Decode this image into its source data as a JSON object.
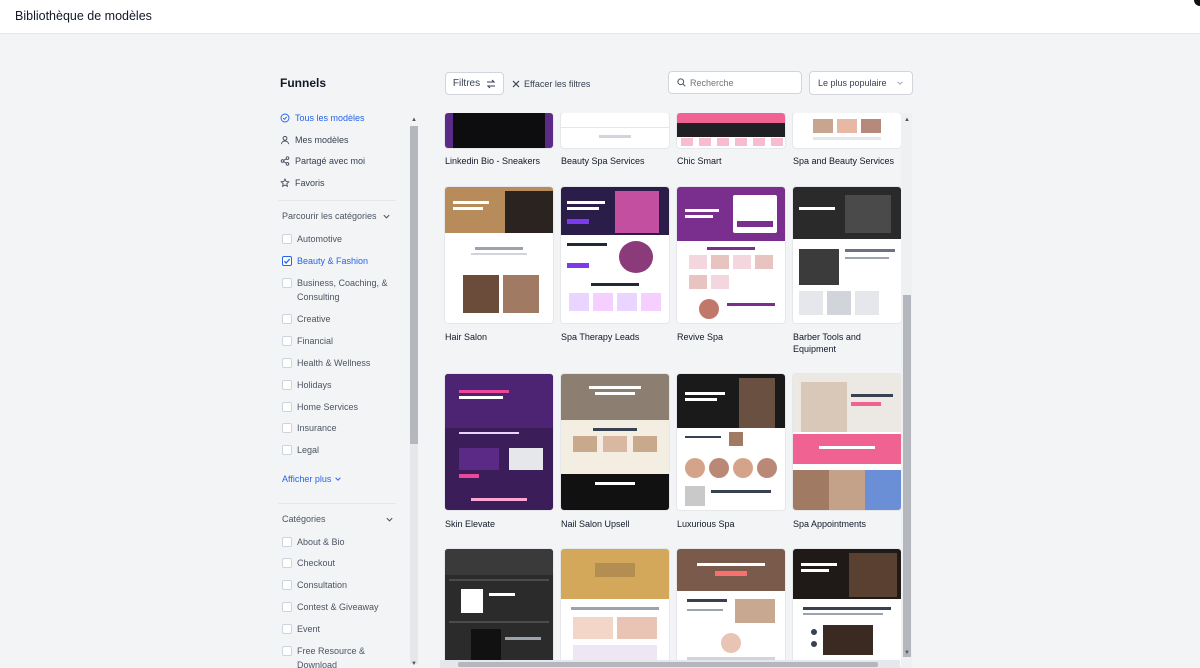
{
  "window": {
    "title": "Bibliothèque de modèles"
  },
  "sidebar": {
    "title": "Funnels",
    "nav": [
      {
        "label": "Tous les modèles",
        "icon": "check-circle-icon",
        "active": true
      },
      {
        "label": "Mes modèles",
        "icon": "user-icon",
        "active": false
      },
      {
        "label": "Partagé avec moi",
        "icon": "share-icon",
        "active": false
      },
      {
        "label": "Favoris",
        "icon": "star-icon",
        "active": false
      }
    ],
    "browse_categories": {
      "label": "Parcourir les catégories",
      "items": [
        {
          "label": "Automotive",
          "checked": false
        },
        {
          "label": "Beauty & Fashion",
          "checked": true
        },
        {
          "label": "Business, Coaching, & Consulting",
          "checked": false
        },
        {
          "label": "Creative",
          "checked": false
        },
        {
          "label": "Financial",
          "checked": false
        },
        {
          "label": "Health & Wellness",
          "checked": false
        },
        {
          "label": "Holidays",
          "checked": false
        },
        {
          "label": "Home Services",
          "checked": false
        },
        {
          "label": "Insurance",
          "checked": false
        },
        {
          "label": "Legal",
          "checked": false
        }
      ],
      "show_more": "Afficher plus"
    },
    "categories": {
      "label": "Catégories",
      "items": [
        {
          "label": "About & Bio",
          "checked": false
        },
        {
          "label": "Checkout",
          "checked": false
        },
        {
          "label": "Consultation",
          "checked": false
        },
        {
          "label": "Contest & Giveaway",
          "checked": false
        },
        {
          "label": "Event",
          "checked": false
        },
        {
          "label": "Free Resource & Download",
          "checked": false
        }
      ]
    }
  },
  "toolbar": {
    "filters_label": "Filtres",
    "clear_label": "Effacer les filtres",
    "search_placeholder": "Recherche",
    "sort_value": "Le plus populaire"
  },
  "templates": [
    {
      "name": "Linkedin Bio - Sneakers"
    },
    {
      "name": "Beauty Spa Services"
    },
    {
      "name": "Chic Smart"
    },
    {
      "name": "Spa and Beauty Services"
    },
    {
      "name": "Hair Salon"
    },
    {
      "name": "Spa Therapy Leads"
    },
    {
      "name": "Revive Spa"
    },
    {
      "name": "Barber Tools and Equipment"
    },
    {
      "name": "Skin Elevate"
    },
    {
      "name": "Nail Salon Upsell"
    },
    {
      "name": "Luxurious Spa"
    },
    {
      "name": "Spa Appointments"
    },
    {
      "name": ""
    },
    {
      "name": ""
    },
    {
      "name": ""
    },
    {
      "name": ""
    }
  ],
  "colors": {
    "accent": "#2563eb",
    "purple": "#5b2a86",
    "pink": "#f06292",
    "dark": "#1f1f24"
  }
}
